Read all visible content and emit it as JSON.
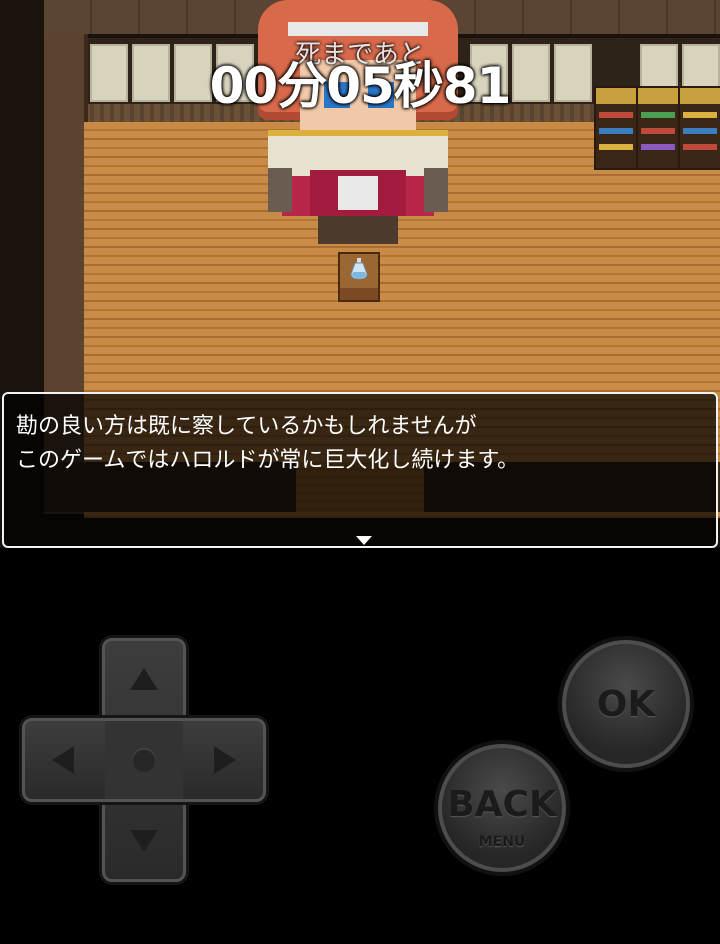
{
  "timer": {
    "label": "死まであと",
    "value": "00分05秒81"
  },
  "message": {
    "line1": "勘の良い方は既に察しているかもしれませんが",
    "line2": "このゲームではハロルドが常に巨大化し続けます。"
  },
  "controls": {
    "ok_label": "OK",
    "back_label": "BACK",
    "back_sub_label": "MENU"
  }
}
